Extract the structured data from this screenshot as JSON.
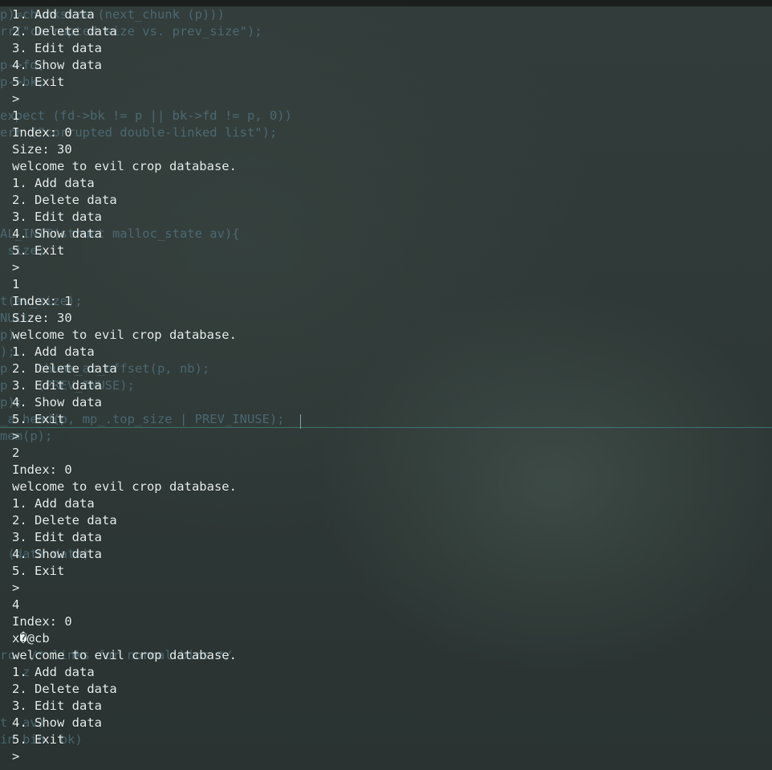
{
  "background_editor": {
    "lines": [
      "p)=chunksize (next_chunk (p)))",
      "rr(\"corrupted size vs. prev_size\");",
      "",
      "p->fd;",
      "p->bk;",
      "",
      "expect (fd->bk != p || bk->fd != p, 0))",
      "err (\"corrupted double-linked list\");",
      "",
      "",
      "",
      "",
      "",
      "AL_INIT(struct malloc_state av){",
      " size;",
      "",
      "",
      "t(av_size);",
      "NULL",
      "p);",
      ");",
      "p    chunk_at_offset(p, nb);",
      "p    (PREV_INUSE);",
      "p);",
      "_a head(p, mp_.top_size | PREV_INUSE);",
      "mem(p);",
      "",
      "",
      "",
      "",
      "",
      "",
      " (data data)",
      "",
      "",
      "",
      "",
      "",
      "rc  /* links for normal bins */",
      "   z",
      "",
      "",
      "t  av)",
      "in bin  bk)"
    ]
  },
  "terminal": {
    "lines": [
      "1. Add data",
      "2. Delete data",
      "3. Edit data",
      "4. Show data",
      "5. Exit",
      ">",
      "1",
      "Index: 0",
      "Size: 30",
      "welcome to evil crop database.",
      "1. Add data",
      "2. Delete data",
      "3. Edit data",
      "4. Show data",
      "5. Exit",
      ">",
      "1",
      "Index: 1",
      "Size: 30",
      "welcome to evil crop database.",
      "1. Add data",
      "2. Delete data",
      "3. Edit data",
      "4. Show data",
      "5. Exit",
      ">",
      "2",
      "Index: 0",
      "welcome to evil crop database.",
      "1. Add data",
      "2. Delete data",
      "3. Edit data",
      "4. Show data",
      "5. Exit",
      ">",
      "4",
      "Index: 0",
      "x�@cb",
      "welcome to evil crop database.",
      "1. Add data",
      "2. Delete data",
      "3. Edit data",
      "4. Show data",
      "5. Exit",
      ">"
    ]
  }
}
